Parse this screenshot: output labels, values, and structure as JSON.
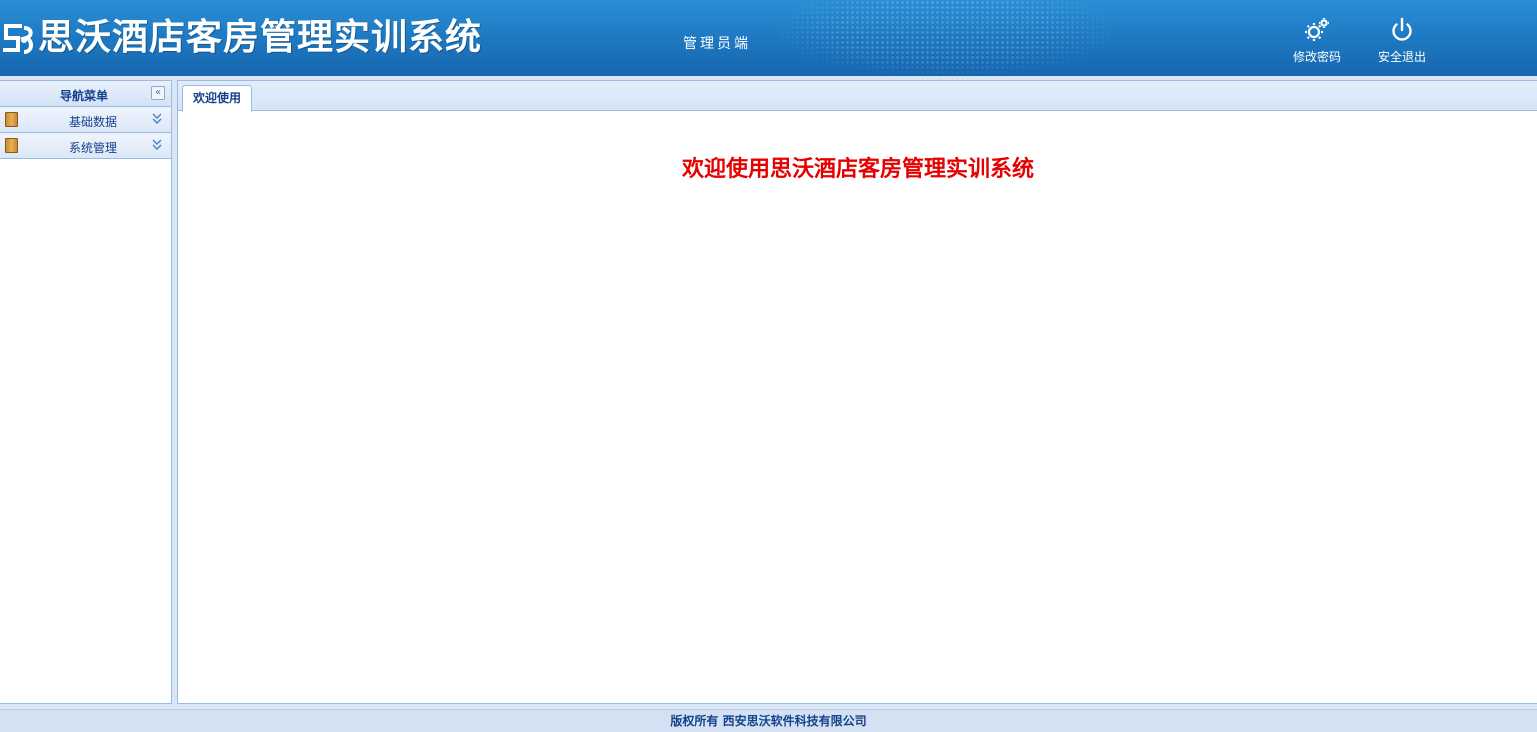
{
  "header": {
    "app_title": "思沃酒店客房管理实训系统",
    "role_label": "管理员端",
    "change_password_label": "修改密码",
    "logout_label": "安全退出",
    "icons": {
      "change_password": "gear-icon",
      "logout": "power-icon",
      "logo": "logo-mark"
    }
  },
  "sidebar": {
    "title": "导航菜单",
    "collapse_icon": "double-chevron-left-icon",
    "groups": [
      {
        "label": "基础数据",
        "icon": "folder-icon",
        "toggle_icon": "double-chevron-down-icon"
      },
      {
        "label": "系统管理",
        "icon": "folder-icon",
        "toggle_icon": "double-chevron-down-icon"
      }
    ]
  },
  "main": {
    "tabs": [
      {
        "label": "欢迎使用",
        "active": true
      }
    ],
    "welcome_text": "欢迎使用思沃酒店客房管理实训系统"
  },
  "footer": {
    "copyright": "版权所有 西安思沃软件科技有限公司"
  },
  "colors": {
    "header_blue": "#1f7bc4",
    "accent_red": "#e60000",
    "nav_text": "#15428b",
    "border": "#99bbe8"
  }
}
